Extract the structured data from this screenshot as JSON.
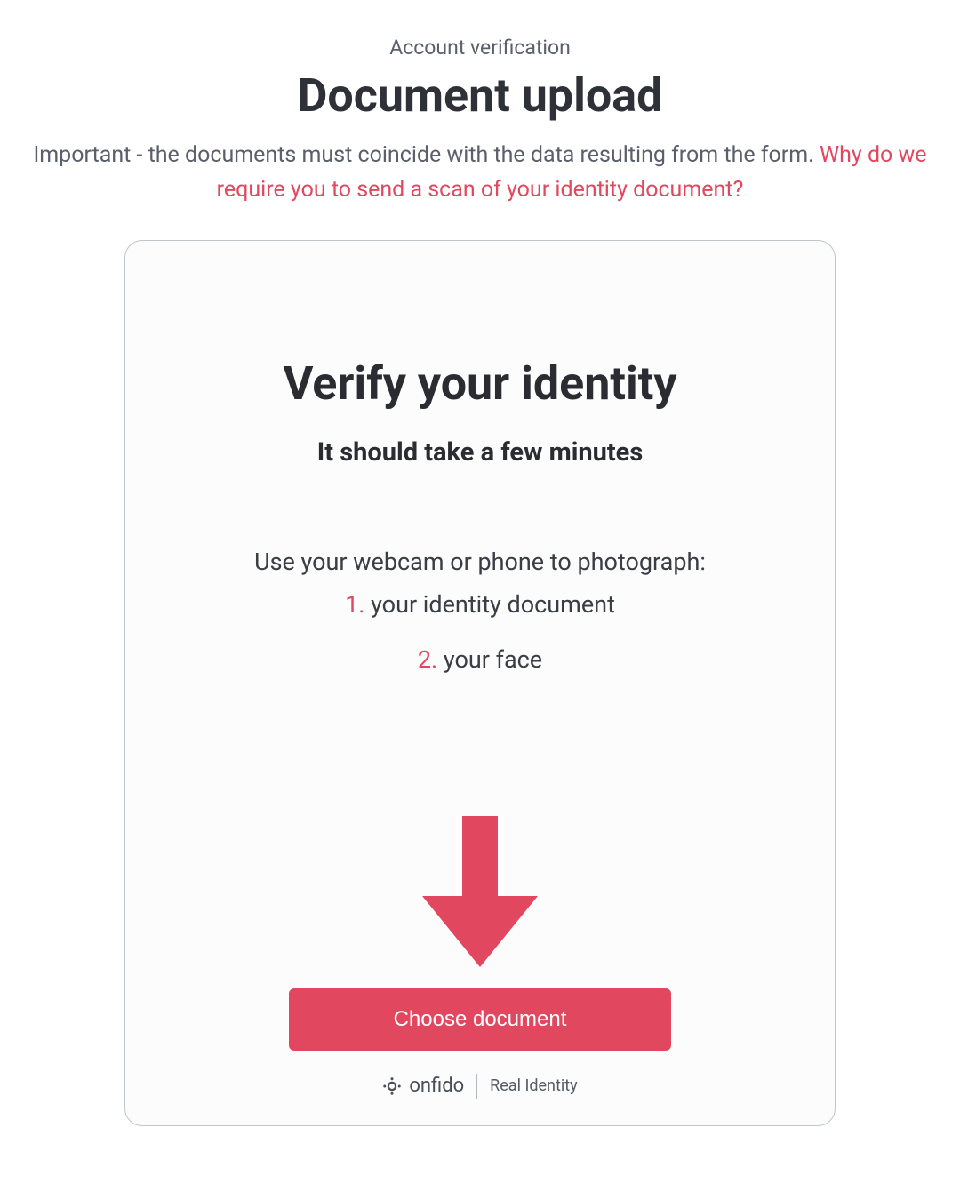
{
  "header": {
    "eyebrow": "Account verification",
    "title": "Document upload",
    "important_text": "Important - the documents must coincide with the data resulting from the form. ",
    "important_link": "Why do we require you to send a scan of your identity document?"
  },
  "card": {
    "title": "Verify your identity",
    "subtitle": "It should take a few minutes",
    "instructions_lead": "Use your webcam or phone to photograph:",
    "step1": {
      "num": "1.",
      "text": " your identity document"
    },
    "step2": {
      "num": "2.",
      "text": " your face"
    },
    "button_label": "Choose document"
  },
  "footer": {
    "brand_name": "onfido",
    "brand_tagline": "Real Identity"
  },
  "colors": {
    "accent": "#e1485f",
    "text_primary": "#2e3138",
    "text_secondary": "#5a5f6b",
    "card_border": "#bfc5cc"
  }
}
